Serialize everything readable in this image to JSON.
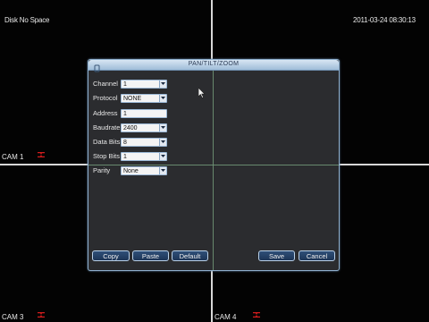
{
  "osd": {
    "disk_status": "Disk No Space",
    "datetime": "2011-03-24 08:30:13"
  },
  "cameras": [
    {
      "label": "CAM 1"
    },
    {
      "label": "CAM 3"
    },
    {
      "label": "CAM 4"
    }
  ],
  "dialog": {
    "title": "PAN/TILT/ZOOM",
    "fields": {
      "channel": {
        "label": "Channel",
        "value": "1"
      },
      "protocol": {
        "label": "Protocol",
        "value": "NONE"
      },
      "address": {
        "label": "Address",
        "value": "1"
      },
      "baudrate": {
        "label": "Baudrate",
        "value": "2400"
      },
      "data_bits": {
        "label": "Data Bits",
        "value": "8"
      },
      "stop_bits": {
        "label": "Stop Bits",
        "value": "1"
      },
      "parity": {
        "label": "Parity",
        "value": "None"
      }
    },
    "buttons": {
      "copy": "Copy",
      "paste": "Paste",
      "default": "Default",
      "save": "Save",
      "cancel": "Cancel"
    }
  },
  "colors": {
    "accent": "#9bb8d6",
    "button_fill": "#1d3557",
    "rec_icon": "#d21c1c"
  }
}
